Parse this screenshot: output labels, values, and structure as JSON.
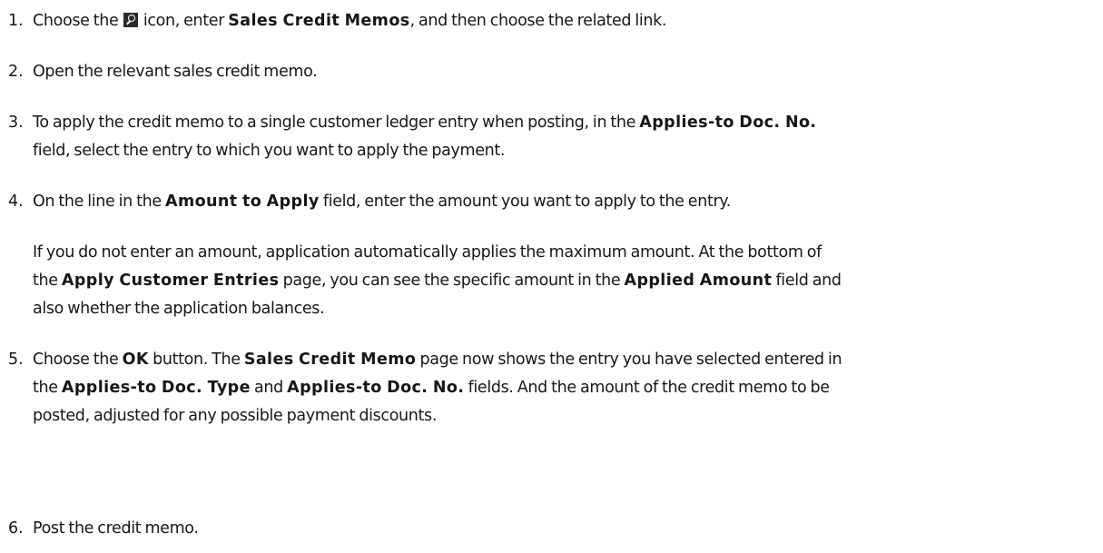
{
  "steps": [
    {
      "number": "1.",
      "lines": [
        [
          {
            "text": "Choose the "
          },
          {
            "icon": "search-icon"
          },
          {
            "text": " icon, enter "
          },
          {
            "text": "Sales Credit Memos",
            "ui": true
          },
          {
            "text": ", and then choose the related link."
          }
        ]
      ]
    },
    {
      "number": "2.",
      "lines": [
        [
          {
            "text": "Open the relevant sales credit memo."
          }
        ]
      ]
    },
    {
      "number": "3.",
      "lines": [
        [
          {
            "text": "To apply the credit memo to a single customer ledger entry when posting, in the "
          },
          {
            "text": "Applies-to Doc. No.",
            "ui": true
          }
        ],
        [
          {
            "text": "field, select the entry to which you want to apply the payment."
          }
        ]
      ]
    },
    {
      "number": "4.",
      "lines": [
        [
          {
            "text": "On the line in the "
          },
          {
            "text": "Amount to Apply",
            "ui": true
          },
          {
            "text": " field, enter the amount you want to apply to the entry."
          }
        ]
      ],
      "note_lines": [
        [
          {
            "text": "If you do not enter an amount, application automatically applies the maximum amount. At the bottom of"
          }
        ],
        [
          {
            "text": "the "
          },
          {
            "text": "Apply Customer Entries",
            "ui": true
          },
          {
            "text": " page, you can see the specific amount in the "
          },
          {
            "text": "Applied Amount",
            "ui": true
          },
          {
            "text": " field and"
          }
        ],
        [
          {
            "text": "also whether the application balances."
          }
        ]
      ]
    },
    {
      "number": "5.",
      "lines": [
        [
          {
            "text": "Choose the "
          },
          {
            "text": "OK",
            "ui": true
          },
          {
            "text": " button. The "
          },
          {
            "text": "Sales Credit Memo",
            "ui": true
          },
          {
            "text": " page now shows the entry you have selected entered in"
          }
        ],
        [
          {
            "text": "the "
          },
          {
            "text": "Applies-to Doc. Type",
            "ui": true
          },
          {
            "text": " and "
          },
          {
            "text": "Applies-to Doc. No.",
            "ui": true
          },
          {
            "text": " fields. And the amount of the credit memo to be"
          }
        ],
        [
          {
            "text": "posted, adjusted for any possible payment discounts."
          }
        ]
      ]
    },
    {
      "number": "6.",
      "lines": [
        [
          {
            "text": "Post the credit memo."
          }
        ]
      ]
    }
  ]
}
